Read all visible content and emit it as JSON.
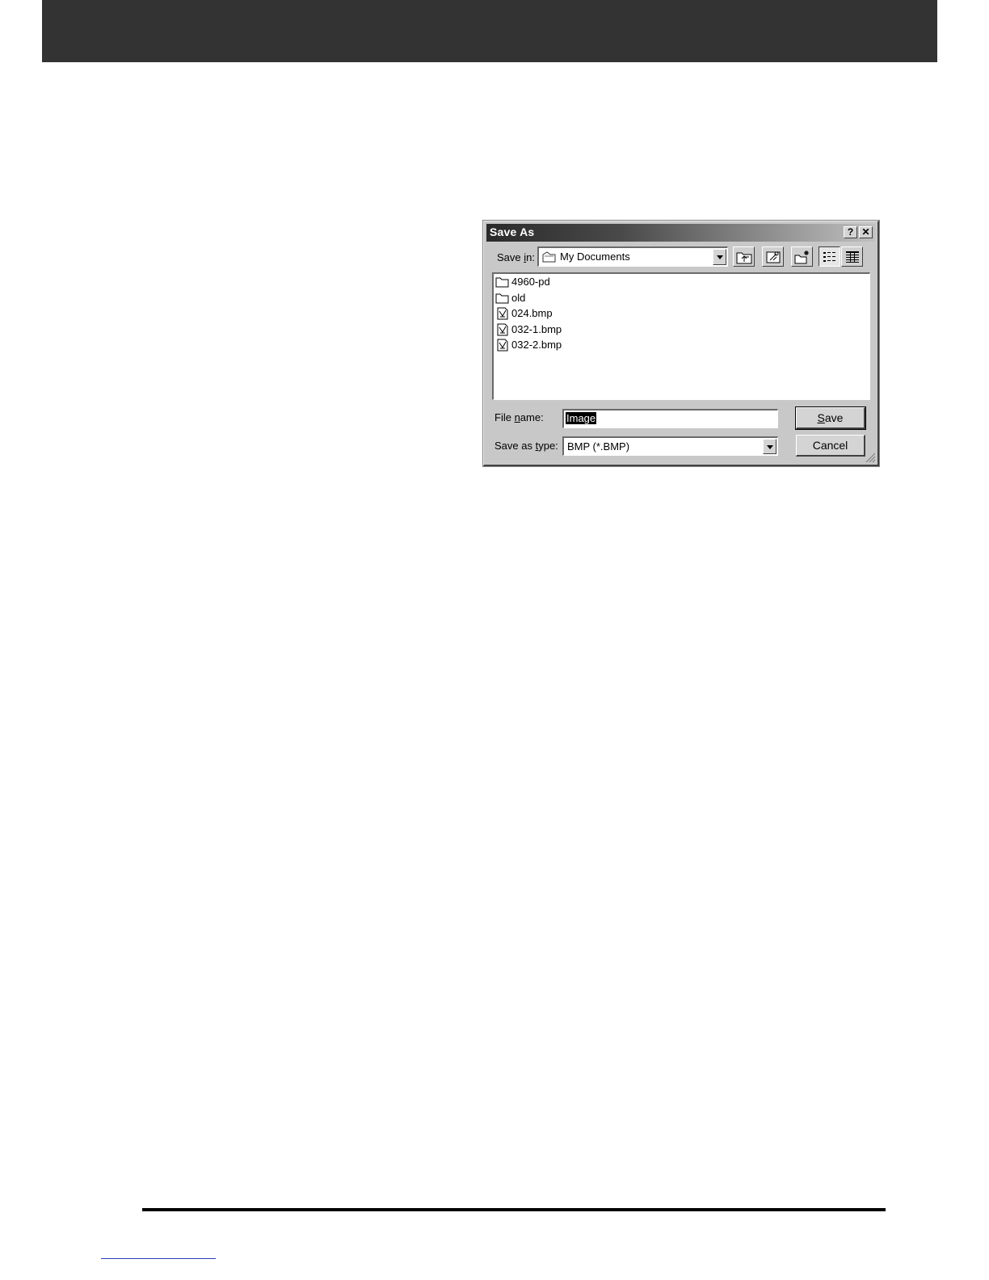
{
  "dialog": {
    "title": "Save As",
    "help_label": "?",
    "close_label": "✕",
    "save_in": {
      "label_pre": "Save ",
      "label_u": "i",
      "label_post": "n:",
      "value": "My Documents"
    },
    "toolbar": {
      "buttons": [
        "up-one-level",
        "desktop",
        "create-new-folder",
        "list-view",
        "details-view"
      ]
    },
    "files": [
      {
        "name": "4960-pd",
        "type": "folder"
      },
      {
        "name": "old",
        "type": "folder"
      },
      {
        "name": "024.bmp",
        "type": "bitmap"
      },
      {
        "name": "032-1.bmp",
        "type": "bitmap"
      },
      {
        "name": "032-2.bmp",
        "type": "bitmap"
      }
    ],
    "file_name": {
      "label_pre": "File ",
      "label_u": "n",
      "label_post": "ame:",
      "value": "Image"
    },
    "save_as_type": {
      "label_pre": "Save as ",
      "label_u": "t",
      "label_post": "ype:",
      "value": "BMP (*.BMP)"
    },
    "buttons": {
      "save_u": "S",
      "save_rest": "ave",
      "cancel": "Cancel"
    }
  }
}
